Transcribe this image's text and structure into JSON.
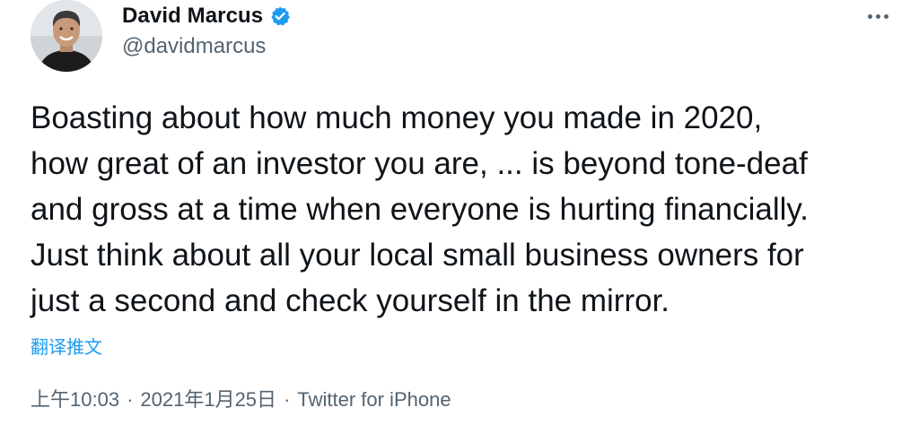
{
  "author": {
    "display_name": "David Marcus",
    "handle": "@davidmarcus",
    "verified_icon": "verified-badge-icon",
    "avatar_icon": "profile-photo"
  },
  "tweet": {
    "lines": [
      "Boasting about how much money you made in 2020,",
      "how great of an investor you are, ... is beyond tone-deaf",
      "and gross at a time when everyone is hurting financially.",
      "Just think about all your local small business owners for",
      "just a second and check yourself in the mirror."
    ],
    "translate_label": "翻译推文"
  },
  "meta": {
    "time": "上午10:03",
    "separator": "·",
    "date": "2021年1月25日",
    "source": "Twitter for iPhone"
  },
  "actions": {
    "more_icon": "more-options-icon"
  },
  "colors": {
    "text_primary": "#0f1419",
    "text_secondary": "#536471",
    "accent": "#1d9bf0"
  }
}
